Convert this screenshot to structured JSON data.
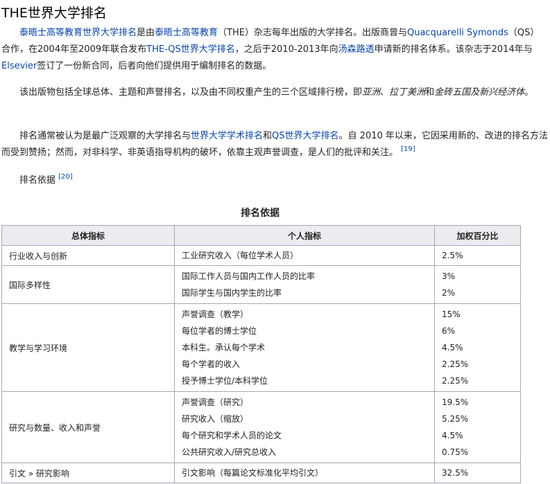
{
  "heading": "THE世界大学排名",
  "p1": {
    "a": "泰晤士高等教育世界大学排名",
    "b": "是由",
    "c": "泰晤士高等教育",
    "d": "（THE）杂志每年出版的大学排名。出版商曾与",
    "e": "Quacquarelli Symonds",
    "f": "（QS）合作，在2004年至2009年联合发布",
    "g": "THE-QS世界大学排名",
    "h": "，之后于2010-2013年向",
    "i": "汤森路透",
    "j": "申请新的排名体系。该杂志于2014年与",
    "k": "Elsevier",
    "l": "签订了一份新合同，后者向他们提供用于编制排名的数据。"
  },
  "p2": {
    "a": "该出版物包括全球总体、主题和声誉排名，以及由不同权重产生的三个区域排行榜，即",
    "b": "亚洲",
    "c": "、",
    "d": "拉丁美洲",
    "e": "和",
    "f": "金砖五国及新兴经济体",
    "g": "。"
  },
  "p3": {
    "a": "排名通常被认为是最广泛观察的大学排名与",
    "b": "世界大学学术排名",
    "c": "和",
    "d": "QS世界大学排名",
    "e": "。自 2010 年以来，它因采用新的、改进的排名方法而受到赞扬；然而，对非科学、非英语指导机构的破坏，依靠主观声誉调查，是人们的批评和关注。",
    "ref": "[19]"
  },
  "p4": {
    "text": "排名依据",
    "ref": "[20]"
  },
  "table": {
    "caption": "排名依据",
    "headers": [
      "总体指标",
      "个人指标",
      "加权百分比"
    ],
    "groups": [
      {
        "name": "行业收入与创新",
        "items": [
          [
            "工业研究收入（每位学术人员）",
            "2.5%"
          ]
        ]
      },
      {
        "name": "国际多样性",
        "items": [
          [
            "国际工作人员与国内工作人员的比率",
            "3%"
          ],
          [
            "国际学生与国内学生的比率",
            "2%"
          ]
        ]
      },
      {
        "name": "教学与学习环境",
        "items": [
          [
            "声誉调查（教学）",
            "15%"
          ],
          [
            "每位学者的博士学位",
            "6%"
          ],
          [
            "本科生。承认每个学术",
            "4.5%"
          ],
          [
            "每个学者的收入",
            "2.25%"
          ],
          [
            "授予博士学位/本科学位",
            "2.25%"
          ]
        ]
      },
      {
        "name": "研究与数量、收入和声誉",
        "items": [
          [
            "声誉调查（研究）",
            "19.5%"
          ],
          [
            "研究收入（缩放）",
            "5.25%"
          ],
          [
            "每个研究和学术人员的论文",
            "4.5%"
          ],
          [
            "公共研究收入/研究总收入",
            "0.75%"
          ]
        ]
      },
      {
        "name": "引文 » 研究影响",
        "items": [
          [
            "引文影响（每篇论文标准化平均引文）",
            "32.5%"
          ]
        ]
      }
    ]
  }
}
